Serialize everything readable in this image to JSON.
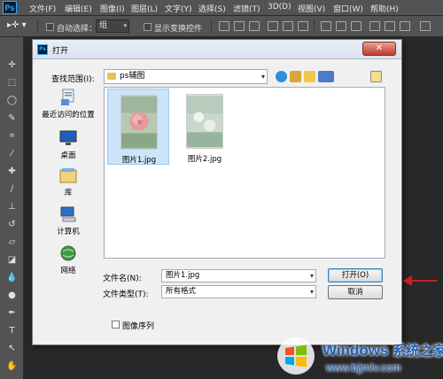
{
  "app": {
    "logo": "Ps",
    "menu": [
      "文件(F)",
      "编辑(E)",
      "图像(I)",
      "图层(L)",
      "文字(Y)",
      "选择(S)",
      "滤镜(T)",
      "3D(D)",
      "视图(V)",
      "窗口(W)",
      "帮助(H)"
    ]
  },
  "options_bar": {
    "auto_select_label": "自动选择：",
    "auto_select_value": "组",
    "show_transform_label": "显示变换控件"
  },
  "dialog": {
    "title": "打开",
    "look_in_label": "查找范围(I):",
    "look_in_value": "ps辅图",
    "places": [
      {
        "label": "最近访问的位置",
        "icon": "recent-places-icon"
      },
      {
        "label": "桌面",
        "icon": "desktop-icon"
      },
      {
        "label": "库",
        "icon": "libraries-icon"
      },
      {
        "label": "计算机",
        "icon": "computer-icon"
      },
      {
        "label": "网络",
        "icon": "network-icon"
      }
    ],
    "files": [
      {
        "name": "图片1.jpg",
        "selected": true
      },
      {
        "name": "图片2.jpg",
        "selected": false
      }
    ],
    "file_name_label": "文件名(N):",
    "file_name_value": "图片1.jpg",
    "file_type_label": "文件类型(T):",
    "file_type_value": "所有格式",
    "open_button": "打开(O)",
    "cancel_button": "取消",
    "image_sequence_label": "图像序列",
    "close_glyph": "✕"
  },
  "watermark": {
    "brand": "Windows",
    "brand_cn": "系统之家",
    "url": "www.bjjmlv.com"
  }
}
